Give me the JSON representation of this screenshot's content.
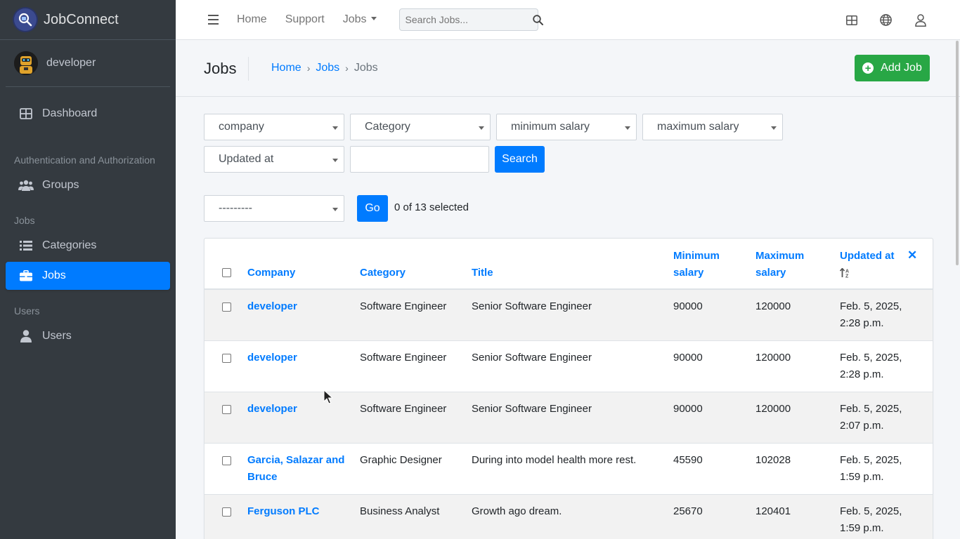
{
  "brand": {
    "name": "JobConnect",
    "icon": "jobconnect-logo"
  },
  "user": {
    "name": "developer",
    "icon": "robot-avatar"
  },
  "sidebar": {
    "items": [
      {
        "label": "Dashboard",
        "icon": "dashboard-icon"
      },
      {
        "header": "Authentication and Authorization"
      },
      {
        "label": "Groups",
        "icon": "users-icon"
      },
      {
        "header": "Jobs"
      },
      {
        "label": "Categories",
        "icon": "list-icon"
      },
      {
        "label": "Jobs",
        "icon": "briefcase-icon",
        "active": true
      },
      {
        "header": "Users"
      },
      {
        "label": "Users",
        "icon": "user-icon"
      }
    ]
  },
  "topbar": {
    "links": [
      "Home",
      "Support",
      "Jobs"
    ],
    "search_placeholder": "Search Jobs..."
  },
  "header": {
    "title": "Jobs",
    "breadcrumb": [
      "Home",
      "Jobs",
      "Jobs"
    ],
    "add_button": "Add Job"
  },
  "filters": {
    "company": "company",
    "category": "Category",
    "min_salary": "minimum salary",
    "max_salary": "maximum salary",
    "updated_at": "Updated at",
    "search_button": "Search"
  },
  "actions": {
    "action_select": "---------",
    "go_button": "Go",
    "selected_text": "0 of 13 selected"
  },
  "table": {
    "columns": {
      "company": "Company",
      "category": "Category",
      "title": "Title",
      "min_1": "Minimum",
      "min_2": "salary",
      "max_1": "Maximum",
      "max_2": "salary",
      "updated": "Updated at",
      "clear": "✕"
    },
    "rows": [
      {
        "company1": "developer",
        "company2": "",
        "category": "Software Engineer",
        "title": "Senior Software Engineer",
        "min": "90000",
        "max": "120000",
        "updated1": "Feb. 5, 2025,",
        "updated2": "2:28 p.m."
      },
      {
        "company1": "developer",
        "company2": "",
        "category": "Software Engineer",
        "title": "Senior Software Engineer",
        "min": "90000",
        "max": "120000",
        "updated1": "Feb. 5, 2025,",
        "updated2": "2:28 p.m."
      },
      {
        "company1": "developer",
        "company2": "",
        "category": "Software Engineer",
        "title": "Senior Software Engineer",
        "min": "90000",
        "max": "120000",
        "updated1": "Feb. 5, 2025,",
        "updated2": "2:07 p.m."
      },
      {
        "company1": "Garcia, Salazar and",
        "company2": "Bruce",
        "category": "Graphic Designer",
        "title": "During into model health more rest.",
        "min": "45590",
        "max": "102028",
        "updated1": "Feb. 5, 2025,",
        "updated2": "1:59 p.m."
      },
      {
        "company1": "Ferguson PLC",
        "company2": "",
        "category": "Business Analyst",
        "title": "Growth ago dream.",
        "min": "25670",
        "max": "120401",
        "updated1": "Feb. 5, 2025,",
        "updated2": "1:59 p.m."
      }
    ]
  },
  "colors": {
    "primary": "#007bff",
    "success": "#28a745",
    "sidebar": "#343a40"
  }
}
